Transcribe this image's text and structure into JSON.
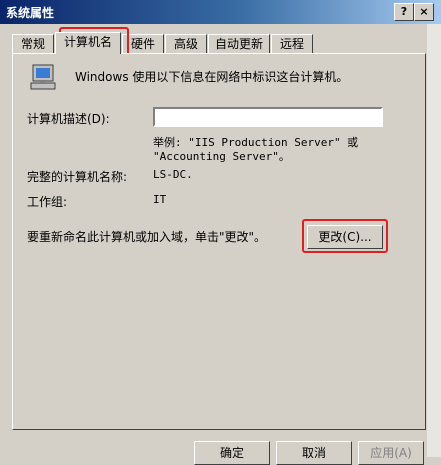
{
  "window": {
    "title": "系统属性",
    "help_button": "?",
    "close_button": "×"
  },
  "tabs": [
    {
      "label": "常规"
    },
    {
      "label": "计算机名"
    },
    {
      "label": "硬件"
    },
    {
      "label": "高级"
    },
    {
      "label": "自动更新"
    },
    {
      "label": "远程"
    }
  ],
  "computer_name_tab": {
    "intro": "Windows 使用以下信息在网络中标识这台计算机。",
    "description_label": "计算机描述(D):",
    "description_value": "",
    "example_line1": "举例: \"IIS Production Server\" 或",
    "example_line2": "\"Accounting Server\"。",
    "full_name_label": "完整的计算机名称:",
    "full_name_value": "LS-DC.",
    "workgroup_label": "工作组:",
    "workgroup_value": "IT",
    "rename_text": "要重新命名此计算机或加入域，单击\"更改\"。",
    "change_button": "更改(C)..."
  },
  "footer": {
    "ok": "确定",
    "cancel": "取消",
    "apply": "应用(A)"
  }
}
